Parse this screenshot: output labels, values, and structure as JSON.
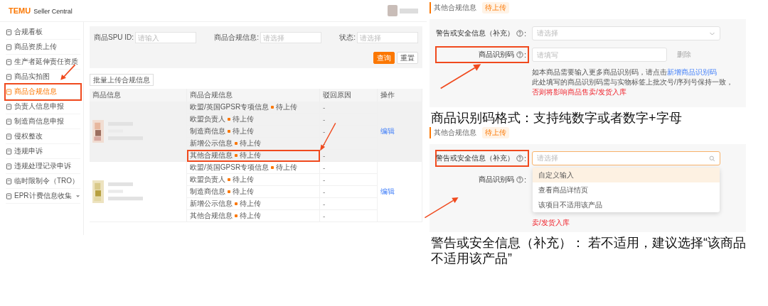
{
  "seller_central": {
    "logo": "TEMU",
    "logo_subtitle": "Seller Central",
    "sidebar": [
      {
        "label": "合规看板",
        "selected": false,
        "annotated": false,
        "expandable": false
      },
      {
        "label": "商品资质上传",
        "selected": false,
        "annotated": false,
        "expandable": false
      },
      {
        "label": "生产者延伸责任资质",
        "selected": false,
        "annotated": false,
        "expandable": false
      },
      {
        "label": "商品实拍图",
        "selected": false,
        "annotated": false,
        "expandable": false
      },
      {
        "label": "商品合规信息",
        "selected": true,
        "annotated": true,
        "expandable": false
      },
      {
        "label": "负责人信息申报",
        "selected": false,
        "annotated": false,
        "expandable": false
      },
      {
        "label": "制造商信息申报",
        "selected": false,
        "annotated": false,
        "expandable": false
      },
      {
        "label": "侵权整改",
        "selected": false,
        "annotated": false,
        "expandable": false
      },
      {
        "label": "违规申诉",
        "selected": false,
        "annotated": false,
        "expandable": false
      },
      {
        "label": "违规处理记录申诉",
        "selected": false,
        "annotated": false,
        "expandable": false
      },
      {
        "label": "临时限制令（TRO）",
        "selected": false,
        "annotated": false,
        "expandable": false
      },
      {
        "label": "EPR计费信息收集",
        "selected": false,
        "annotated": false,
        "expandable": true
      }
    ],
    "filters": [
      {
        "label": "商品SPU ID:",
        "placeholder": "请输入"
      },
      {
        "label": "商品合规信息:",
        "placeholder": "请选择"
      },
      {
        "label": "状态:",
        "placeholder": "请选择"
      }
    ],
    "buttons": [
      {
        "label": "查询",
        "kind": "primary"
      },
      {
        "label": "重置",
        "kind": "default"
      }
    ],
    "batch_button": "批量上传合规信息",
    "table": {
      "columns": [
        "商品信息",
        "商品合规信息",
        "驳回原因",
        "操作"
      ],
      "products": [
        {
          "hovered": true,
          "action": "编辑",
          "items": [
            {
              "name": "欧盟/英国GPSR专项信息",
              "status": "待上传",
              "reason": "-",
              "annotated": false
            },
            {
              "name": "欧盟负责人",
              "status": "待上传",
              "reason": "-",
              "annotated": false
            },
            {
              "name": "制造商信息",
              "status": "待上传",
              "reason": "-",
              "annotated": false
            },
            {
              "name": "新增公示信息",
              "status": "待上传",
              "reason": "-",
              "annotated": false
            },
            {
              "name": "其他合规信息",
              "status": "待上传",
              "reason": "-",
              "annotated": true
            }
          ]
        },
        {
          "hovered": false,
          "action": "编辑",
          "items": [
            {
              "name": "欧盟/英国GPSR专项信息",
              "status": "待上传",
              "reason": "-",
              "annotated": false
            },
            {
              "name": "欧盟负责人",
              "status": "待上传",
              "reason": "-",
              "annotated": false
            },
            {
              "name": "制造商信息",
              "status": "待上传",
              "reason": "-",
              "annotated": false
            },
            {
              "name": "新增公示信息",
              "status": "待上传",
              "reason": "-",
              "annotated": false
            },
            {
              "name": "其他合规信息",
              "status": "待上传",
              "reason": "-",
              "annotated": false
            }
          ]
        }
      ]
    }
  },
  "panels": [
    {
      "header": "其他合规信息",
      "badge": "待上传",
      "fields": [
        {
          "kind": "select",
          "label": "警告或安全信息（补充）",
          "separator": ":",
          "placeholder": "请选择",
          "open": false,
          "annotated": false
        },
        {
          "kind": "input",
          "label": "商品识别码",
          "separator": ":",
          "placeholder": "请填写",
          "delete": "删除",
          "annotated": true
        }
      ],
      "help": [
        [
          {
            "kind": "plain",
            "text": "如本商品需要输入更多商品识别码，请点击"
          },
          {
            "kind": "link",
            "text": "新增商品识别码"
          }
        ],
        [
          {
            "kind": "plain",
            "text": "此处填写的商品识别码需与实物标签上批次号/序列号保持一致，"
          },
          {
            "kind": "warning",
            "text": "否则将影响商品售卖/发货入库"
          }
        ]
      ],
      "caption": "商品识别码格式：支持纯数字或者数字+字母"
    },
    {
      "header": "其他合规信息",
      "badge": "待上传",
      "fields": [
        {
          "kind": "select",
          "label": "警告或安全信息（补充）",
          "separator": ":",
          "placeholder": "请选择",
          "open": true,
          "annotated": true,
          "options": [
            {
              "label": "自定义输入",
              "highlighted": true
            },
            {
              "label": "查看商品详情页",
              "highlighted": false
            },
            {
              "label": "该项目不适用该产品",
              "highlighted": false
            }
          ]
        },
        {
          "kind": "input",
          "label": "商品识别码",
          "separator": ":",
          "annotated": false
        }
      ],
      "help": [
        [
          {
            "kind": "warning",
            "text": "卖/发货入库"
          }
        ]
      ],
      "caption": "警告或安全信息（补充）： 若不适用，建议选择“该商品不适用该产品”"
    }
  ]
}
